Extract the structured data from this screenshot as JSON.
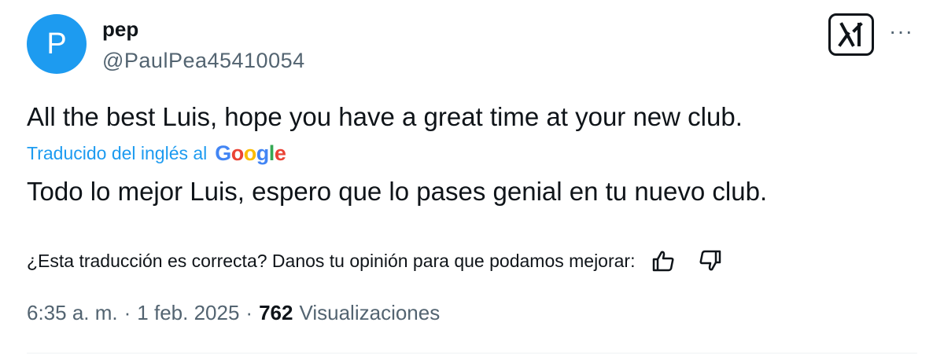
{
  "author": {
    "avatar_letter": "P",
    "name": "pep",
    "handle": "@PaulPea45410054",
    "avatar_color": "#1d9bf0"
  },
  "tweet": {
    "original_text": "All the best Luis, hope you have a great time at your new club.",
    "translated_by": "Traducido del inglés al",
    "translator_brand": "Google",
    "translated_text": "Todo lo mejor Luis, espero que lo pases genial en tu nuevo club.",
    "feedback_prompt": "¿Esta traducción es correcta? Danos tu opinión para que podamos mejorar:",
    "time": "6:35 a. m.",
    "date": "1 feb. 2025",
    "separator": "·",
    "views_count": "762",
    "views_label": "Visualizaciones"
  },
  "icons": {
    "grok": "grok-icon",
    "more": "more-options-icon",
    "thumbs_up": "thumbs-up-icon",
    "thumbs_down": "thumbs-down-icon"
  },
  "colors": {
    "accent": "#1d9bf0",
    "secondary_text": "#536471",
    "primary_text": "#0f1419"
  }
}
